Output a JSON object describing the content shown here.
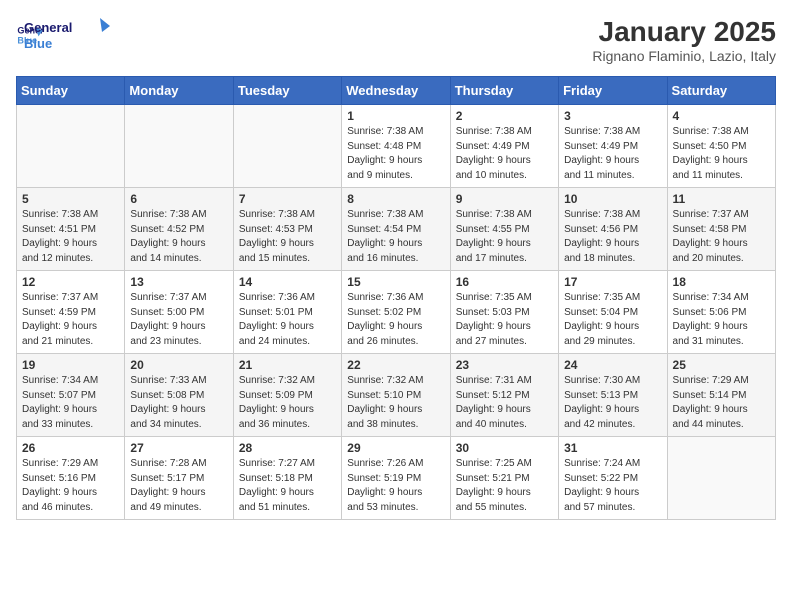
{
  "logo": {
    "line1": "General",
    "line2": "Blue"
  },
  "title": "January 2025",
  "location": "Rignano Flaminio, Lazio, Italy",
  "days_header": [
    "Sunday",
    "Monday",
    "Tuesday",
    "Wednesday",
    "Thursday",
    "Friday",
    "Saturday"
  ],
  "weeks": [
    [
      {
        "day": "",
        "info": ""
      },
      {
        "day": "",
        "info": ""
      },
      {
        "day": "",
        "info": ""
      },
      {
        "day": "1",
        "info": "Sunrise: 7:38 AM\nSunset: 4:48 PM\nDaylight: 9 hours\nand 9 minutes."
      },
      {
        "day": "2",
        "info": "Sunrise: 7:38 AM\nSunset: 4:49 PM\nDaylight: 9 hours\nand 10 minutes."
      },
      {
        "day": "3",
        "info": "Sunrise: 7:38 AM\nSunset: 4:49 PM\nDaylight: 9 hours\nand 11 minutes."
      },
      {
        "day": "4",
        "info": "Sunrise: 7:38 AM\nSunset: 4:50 PM\nDaylight: 9 hours\nand 11 minutes."
      }
    ],
    [
      {
        "day": "5",
        "info": "Sunrise: 7:38 AM\nSunset: 4:51 PM\nDaylight: 9 hours\nand 12 minutes."
      },
      {
        "day": "6",
        "info": "Sunrise: 7:38 AM\nSunset: 4:52 PM\nDaylight: 9 hours\nand 14 minutes."
      },
      {
        "day": "7",
        "info": "Sunrise: 7:38 AM\nSunset: 4:53 PM\nDaylight: 9 hours\nand 15 minutes."
      },
      {
        "day": "8",
        "info": "Sunrise: 7:38 AM\nSunset: 4:54 PM\nDaylight: 9 hours\nand 16 minutes."
      },
      {
        "day": "9",
        "info": "Sunrise: 7:38 AM\nSunset: 4:55 PM\nDaylight: 9 hours\nand 17 minutes."
      },
      {
        "day": "10",
        "info": "Sunrise: 7:38 AM\nSunset: 4:56 PM\nDaylight: 9 hours\nand 18 minutes."
      },
      {
        "day": "11",
        "info": "Sunrise: 7:37 AM\nSunset: 4:58 PM\nDaylight: 9 hours\nand 20 minutes."
      }
    ],
    [
      {
        "day": "12",
        "info": "Sunrise: 7:37 AM\nSunset: 4:59 PM\nDaylight: 9 hours\nand 21 minutes."
      },
      {
        "day": "13",
        "info": "Sunrise: 7:37 AM\nSunset: 5:00 PM\nDaylight: 9 hours\nand 23 minutes."
      },
      {
        "day": "14",
        "info": "Sunrise: 7:36 AM\nSunset: 5:01 PM\nDaylight: 9 hours\nand 24 minutes."
      },
      {
        "day": "15",
        "info": "Sunrise: 7:36 AM\nSunset: 5:02 PM\nDaylight: 9 hours\nand 26 minutes."
      },
      {
        "day": "16",
        "info": "Sunrise: 7:35 AM\nSunset: 5:03 PM\nDaylight: 9 hours\nand 27 minutes."
      },
      {
        "day": "17",
        "info": "Sunrise: 7:35 AM\nSunset: 5:04 PM\nDaylight: 9 hours\nand 29 minutes."
      },
      {
        "day": "18",
        "info": "Sunrise: 7:34 AM\nSunset: 5:06 PM\nDaylight: 9 hours\nand 31 minutes."
      }
    ],
    [
      {
        "day": "19",
        "info": "Sunrise: 7:34 AM\nSunset: 5:07 PM\nDaylight: 9 hours\nand 33 minutes."
      },
      {
        "day": "20",
        "info": "Sunrise: 7:33 AM\nSunset: 5:08 PM\nDaylight: 9 hours\nand 34 minutes."
      },
      {
        "day": "21",
        "info": "Sunrise: 7:32 AM\nSunset: 5:09 PM\nDaylight: 9 hours\nand 36 minutes."
      },
      {
        "day": "22",
        "info": "Sunrise: 7:32 AM\nSunset: 5:10 PM\nDaylight: 9 hours\nand 38 minutes."
      },
      {
        "day": "23",
        "info": "Sunrise: 7:31 AM\nSunset: 5:12 PM\nDaylight: 9 hours\nand 40 minutes."
      },
      {
        "day": "24",
        "info": "Sunrise: 7:30 AM\nSunset: 5:13 PM\nDaylight: 9 hours\nand 42 minutes."
      },
      {
        "day": "25",
        "info": "Sunrise: 7:29 AM\nSunset: 5:14 PM\nDaylight: 9 hours\nand 44 minutes."
      }
    ],
    [
      {
        "day": "26",
        "info": "Sunrise: 7:29 AM\nSunset: 5:16 PM\nDaylight: 9 hours\nand 46 minutes."
      },
      {
        "day": "27",
        "info": "Sunrise: 7:28 AM\nSunset: 5:17 PM\nDaylight: 9 hours\nand 49 minutes."
      },
      {
        "day": "28",
        "info": "Sunrise: 7:27 AM\nSunset: 5:18 PM\nDaylight: 9 hours\nand 51 minutes."
      },
      {
        "day": "29",
        "info": "Sunrise: 7:26 AM\nSunset: 5:19 PM\nDaylight: 9 hours\nand 53 minutes."
      },
      {
        "day": "30",
        "info": "Sunrise: 7:25 AM\nSunset: 5:21 PM\nDaylight: 9 hours\nand 55 minutes."
      },
      {
        "day": "31",
        "info": "Sunrise: 7:24 AM\nSunset: 5:22 PM\nDaylight: 9 hours\nand 57 minutes."
      },
      {
        "day": "",
        "info": ""
      }
    ]
  ]
}
